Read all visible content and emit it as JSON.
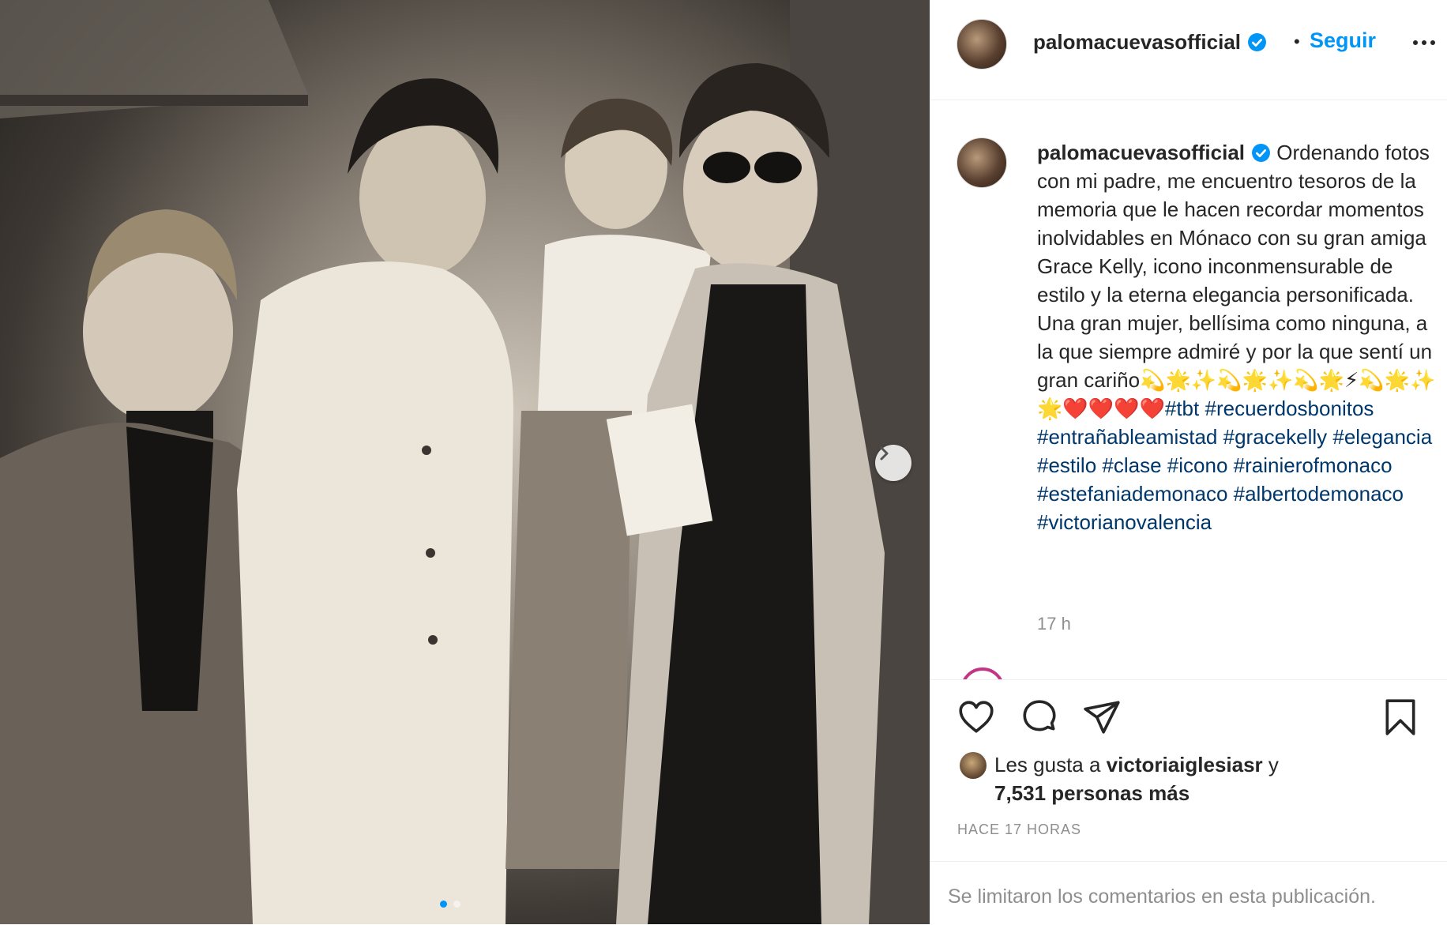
{
  "post": {
    "username": "palomacuevasofficial",
    "separator": "•",
    "follow_label": "Seguir",
    "verified_icon": "verified-badge-icon",
    "accent_color": "#0095f6",
    "slide_count": 2,
    "active_slide": 1
  },
  "caption": {
    "username": "palomacuevasofficial",
    "text": "Ordenando fotos con mi padre, me encuentro tesoros de la memoria que le hacen recordar momentos inolvidables en Mónaco con su gran amiga Grace Kelly, icono inconmensurable de estilo y la eterna elegancia personificada. Una gran mujer, bellísima como ninguna, a la que siempre admiré y por la que sentí un gran cariño💫🌟✨💫🌟✨💫🌟⚡💫🌟✨🌟❤️❤️❤️❤️",
    "hashtags": [
      "#tbt",
      "#recuerdosbonitos",
      "#entrañableamistad",
      "#gracekelly",
      "#elegancia",
      "#estilo",
      "#clase",
      "#icono",
      "#rainierofmonaco",
      "#estefaniademonaco",
      "#albertodemonaco",
      "#victorianovalencia"
    ],
    "time": "17 h"
  },
  "likes": {
    "prefix": "Les gusta a",
    "user": "victoriaiglesiasr",
    "connector": "y",
    "others": "7,531 personas más"
  },
  "posted_ago": "HACE 17 HORAS",
  "comments_limited": "Se limitaron los comentarios en esta publicación."
}
